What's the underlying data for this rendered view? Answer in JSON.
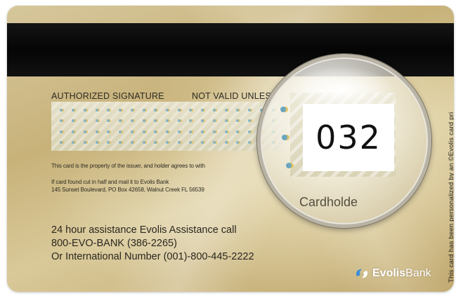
{
  "card": {
    "signature_heading": "AUTHORIZED SIGNATURE",
    "not_valid_text": "NOT VALID UNLES",
    "property_notice": "This card is the property of the issuer, and holder agrees to with",
    "found_card_line1": "If card found cut in half and mail it to Evolis Bank",
    "found_card_line2": "145 Sunset Boulevard, PO Box 42658, Walnut Creek FL 56539",
    "assistance_line1": "24 hour assistance Evolis Assistance call",
    "assistance_line2": "800-EVO-BANK (386-2265)",
    "assistance_line3": "Or International Number (001)-800-445-2222",
    "logo_bold": "Evolis",
    "logo_thin": "Bank",
    "vertical_note": "This card has been personalized by an ©Evolis card pri"
  },
  "magnifier": {
    "cvv": "032",
    "cardholder_fragment": "Cardholde"
  },
  "colors": {
    "card_gold": "#cdb985",
    "stripe": "#0a0a0a",
    "logo_blue": "#3b8ed8"
  }
}
